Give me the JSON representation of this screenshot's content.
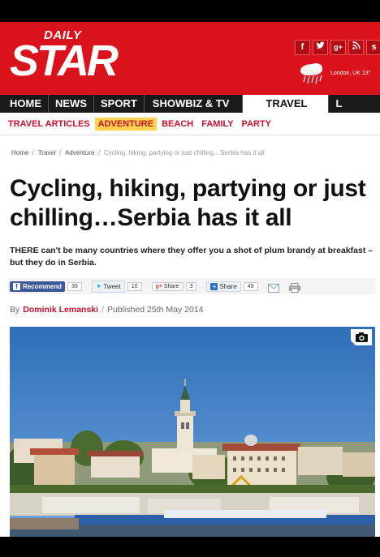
{
  "masthead": {
    "logo_top": "DAILY",
    "logo_main": "STAR",
    "social": [
      "f",
      "t",
      "g+",
      "rss",
      "s"
    ],
    "location": "London, UK 13°"
  },
  "nav": {
    "items": [
      "HOME",
      "NEWS",
      "SPORT",
      "SHOWBIZ & TV",
      "TRAVEL",
      "L"
    ],
    "active": "TRAVEL"
  },
  "subnav": {
    "items": [
      "TRAVEL ARTICLES",
      "ADVENTURE",
      "BEACH",
      "FAMILY",
      "PARTY"
    ],
    "active": "ADVENTURE"
  },
  "breadcrumb": [
    "Home",
    "Travel",
    "Adventure",
    "Cycling, hiking, partying or just chilling…Serbia has it all"
  ],
  "article": {
    "headline": "Cycling, hiking, partying or just chilling…Serbia has it all",
    "standfirst": "THERE can't be many countries where they offer you a shot of plum brandy at breakfast – but they do in Serbia.",
    "author_prefix": "By",
    "author": "Dominik Lemanski",
    "byline_sep": "/",
    "published": "Published 25th May 2014"
  },
  "share": {
    "recommend_label": "Recommend",
    "recommend_count": "39",
    "tweet_label": "Tweet",
    "tweet_count": "10",
    "gplus_label": "Share",
    "gplus_count": "3",
    "share_label": "Share",
    "share_count": "49"
  },
  "colors": {
    "brand_red": "#d9121b",
    "nav_bg": "#1a1a1a",
    "subnav_active": "#ffd34d",
    "link_red": "#c8102e"
  }
}
